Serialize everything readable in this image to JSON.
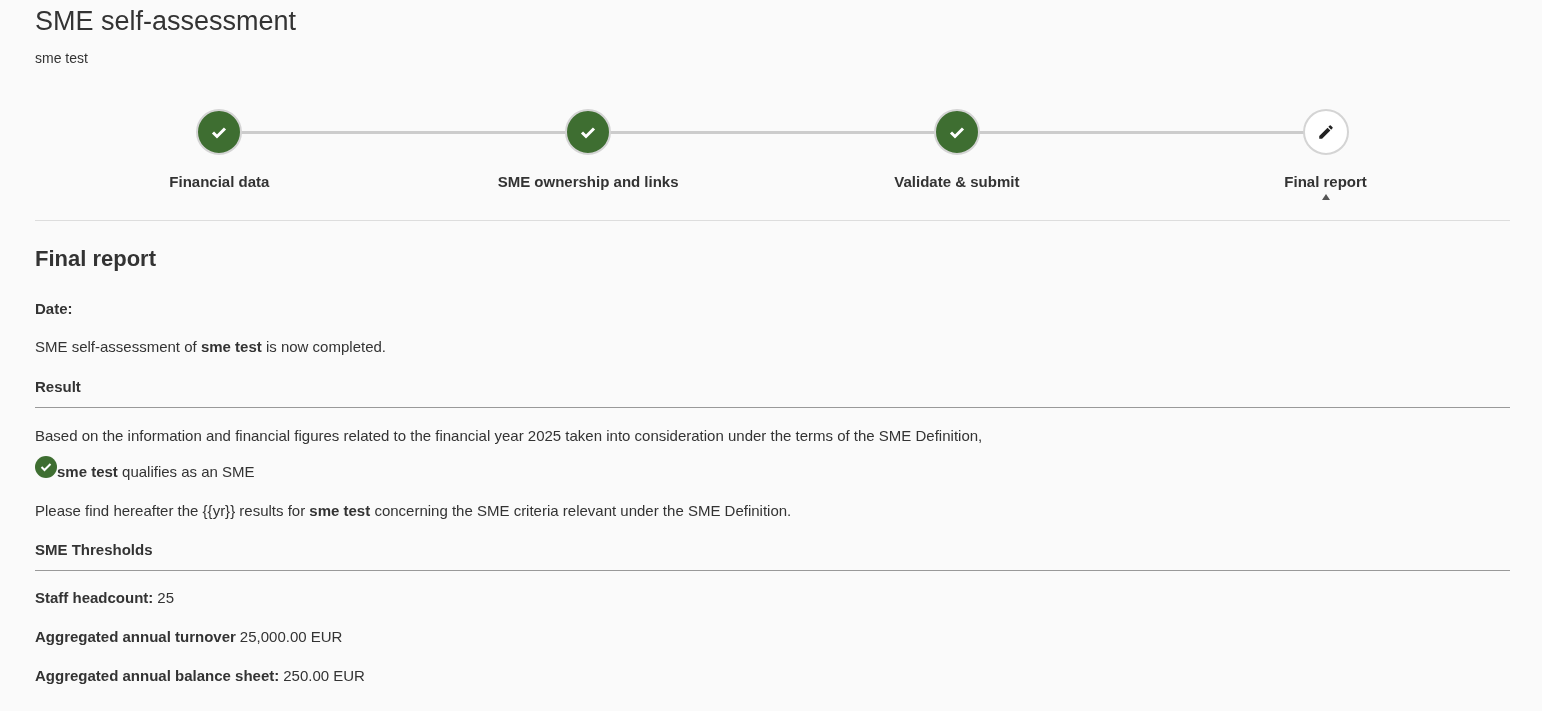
{
  "header": {
    "title": "SME self-assessment",
    "subtitle": "sme test"
  },
  "steps": [
    {
      "label": "Financial data",
      "completed": true,
      "selected": false
    },
    {
      "label": "SME ownership and links",
      "completed": true,
      "selected": false
    },
    {
      "label": "Validate & submit",
      "completed": true,
      "selected": false
    },
    {
      "label": "Final report",
      "completed": false,
      "selected": true
    }
  ],
  "report": {
    "heading": "Final report",
    "date_label": "Date:",
    "completed": "SME self-assessment of **sme test** is now completed.",
    "result_heading": "Result",
    "basis": "Based on the information and financial figures related to the financial year 2025 taken into consideration under the terms of the SME Definition,",
    "qualification": {
      "text": "**sme test** qualifies as an SME",
      "qualified": true
    },
    "intro": "Please find hereafter the {{yr}} results for **sme test** concerning the SME criteria relevant under the SME Definition.",
    "thresholds_heading": "SME Thresholds",
    "thresholds": [
      {
        "label": "Staff headcount:",
        "value": "25"
      },
      {
        "label": "Aggregated annual turnover",
        "value": "25,000.00 EUR"
      },
      {
        "label": "Aggregated annual balance sheet:",
        "value": "250.00 EUR"
      }
    ]
  }
}
